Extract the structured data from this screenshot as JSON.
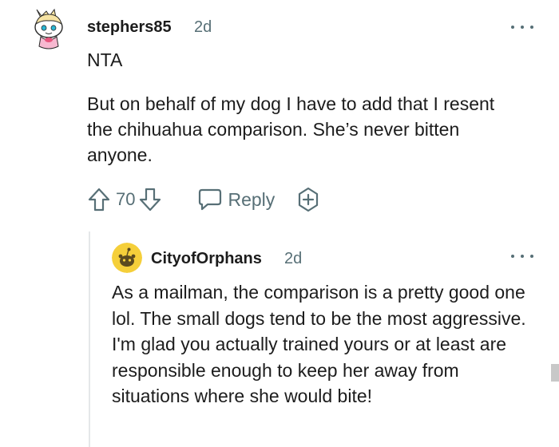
{
  "parent_comment": {
    "username": "stephers85",
    "timestamp": "2d",
    "verdict": "NTA",
    "body": "But on behalf of my dog I have to add that I resent the chihuahua comparison. She’s never bitten anyone.",
    "score": "70",
    "reply_label": "Reply",
    "more_icon": "more-options-icon",
    "upvote_icon": "upvote-arrow-icon",
    "downvote_icon": "downvote-arrow-icon",
    "reply_icon": "speech-bubble-icon",
    "award_icon": "award-plus-icon"
  },
  "reply_comment": {
    "username": "CityofOrphans",
    "timestamp": "2d",
    "body": "As a mailman, the comparison is a pretty good one lol. The small dogs tend to be the most aggressive. I'm glad you actually trained yours or at least are responsible enough to keep her away from situations where she would bite!",
    "avatar_color": "#f5cf3a",
    "more_icon": "more-options-icon"
  }
}
